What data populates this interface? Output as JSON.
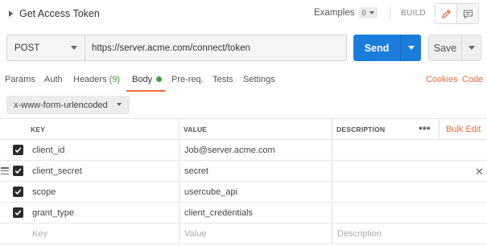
{
  "request": {
    "title": "Get Access Token",
    "method": "POST",
    "url": "https://server.acme.com/connect/token"
  },
  "header": {
    "examples_label": "Examples",
    "examples_count": "0",
    "build_label": "BUILD"
  },
  "actions": {
    "send_label": "Send",
    "save_label": "Save"
  },
  "tabs": {
    "params": "Params",
    "auth": "Auth",
    "headers": "Headers",
    "headers_count": "(9)",
    "body": "Body",
    "prereq": "Pre-req.",
    "tests": "Tests",
    "settings": "Settings",
    "cookies": "Cookies",
    "code": "Code"
  },
  "body_type": "x-www-form-urlencoded",
  "table": {
    "columns": {
      "key": "KEY",
      "value": "VALUE",
      "description": "DESCRIPTION"
    },
    "bulk_edit": "Bulk Edit",
    "rows": [
      {
        "checked": true,
        "key": "client_id",
        "value": "Job@server.acme.com",
        "description": ""
      },
      {
        "checked": true,
        "key": "client_secret",
        "value": "secret",
        "description": ""
      },
      {
        "checked": true,
        "key": "scope",
        "value": "usercube_api",
        "description": ""
      },
      {
        "checked": true,
        "key": "grant_type",
        "value": "client_credentials",
        "description": ""
      }
    ],
    "placeholders": {
      "key": "Key",
      "value": "Value",
      "description": "Description"
    }
  },
  "colors": {
    "accent": "#f26b3a",
    "send_button": "#1a7ddc",
    "body_dot": "#3fa144"
  }
}
